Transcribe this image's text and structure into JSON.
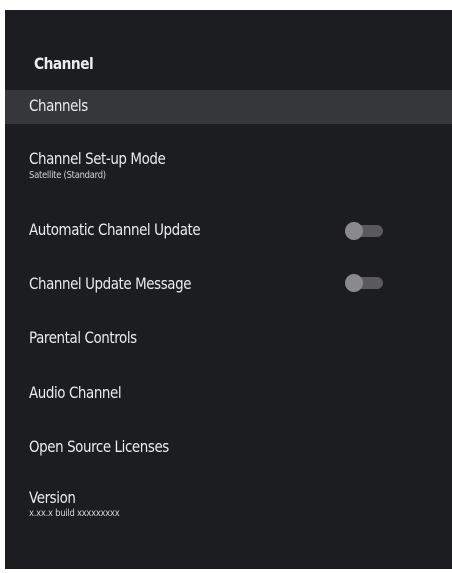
{
  "panel": {
    "title": "Channel"
  },
  "menu": {
    "channels": {
      "label": "Channels"
    },
    "setup_mode": {
      "label": "Channel Set-up Mode",
      "value": "Satellite (Standard)"
    },
    "auto_update": {
      "label": "Automatic Channel Update",
      "enabled": false
    },
    "update_message": {
      "label": "Channel Update Message",
      "enabled": false
    },
    "parental": {
      "label": "Parental Controls"
    },
    "audio": {
      "label": "Audio Channel"
    },
    "licenses": {
      "label": "Open Source Licenses"
    },
    "version": {
      "label": "Version",
      "value": "x.xx.x build xxxxxxxxx"
    }
  },
  "colors": {
    "panel_bg": "#1c1d20",
    "selected_bg": "#36373b",
    "text": "#ececec",
    "toggle_track": "#5a5a5e",
    "toggle_knob": "#8a8a8e"
  }
}
